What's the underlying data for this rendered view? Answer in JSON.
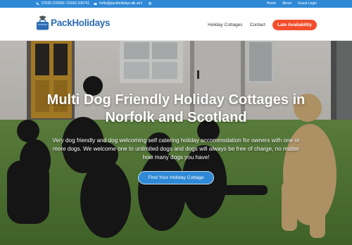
{
  "topbar": {
    "phone": "07935 375099 / 01692 535741",
    "email": "hello@packholidays.co.uk",
    "social": [
      {
        "icon": "facebook-icon",
        "glyph": "f"
      },
      {
        "icon": "twitter-icon",
        "glyph": "t"
      },
      {
        "icon": "instagram-icon",
        "glyph": "◎"
      }
    ],
    "links": [
      "Home",
      "About",
      "Guest Login"
    ]
  },
  "header": {
    "logo_text": "PackHolidays",
    "nav": {
      "holiday_cottages": "Holiday Cottages",
      "contact": "Contact",
      "late_availability": "Late Availability"
    }
  },
  "hero": {
    "title": "Multi Dog Friendly Holiday Cottages in Norfolk and Scotland",
    "subtitle": "Very dog friendly and dog welcoming self catering holiday accommodation for owners with one or more dogs.  We welcome one to unlimited dogs and dogs will always be free of charge, no matter how many dogs you have!",
    "button": "Find Your Holiday Cottage"
  },
  "colors": {
    "brand_blue": "#2f89d6",
    "accent_orange": "#f24e2c",
    "logo_blue": "#2c6cb2"
  }
}
